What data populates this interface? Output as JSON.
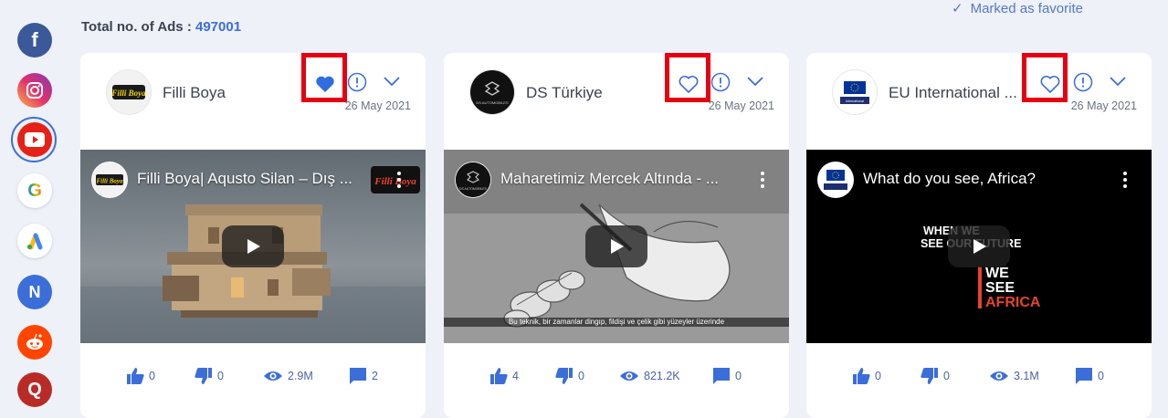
{
  "header": {
    "total_label": "Total no. of Ads :",
    "total_value": "497001",
    "favorite_label": "Marked as favorite"
  },
  "sidebar": {
    "networks": [
      {
        "name": "facebook-icon",
        "glyph": "f",
        "color": "#3b5998"
      },
      {
        "name": "instagram-icon",
        "glyph": "",
        "color": "#d6249f"
      },
      {
        "name": "youtube-icon",
        "glyph": "",
        "color": "#e62117"
      },
      {
        "name": "google-icon",
        "glyph": "G",
        "color": "#ffffff"
      },
      {
        "name": "google-ads-icon",
        "glyph": "",
        "color": "#ffffff"
      },
      {
        "name": "native-icon",
        "glyph": "N",
        "color": "#3b6ed8"
      },
      {
        "name": "reddit-icon",
        "glyph": "",
        "color": "#ff4500"
      },
      {
        "name": "quora-icon",
        "glyph": "Q",
        "color": "#b92b27"
      }
    ],
    "active": "youtube"
  },
  "cards": [
    {
      "advertiser": "Filli Boya",
      "date": "26 May 2021",
      "favorited": true,
      "video_title": "Filli Boya| Aqusto Silan – Dış ...",
      "subtitle": "",
      "stats": {
        "likes": "0",
        "dislikes": "0",
        "views": "2.9M",
        "comments": "2"
      }
    },
    {
      "advertiser": "DS Türkiye",
      "date": "26 May 2021",
      "favorited": false,
      "video_title": "Maharetimiz Mercek Altında - ...",
      "subtitle": "Bu teknik, bir zamanlar dingıp, fildişi ve çelik gibi yüzeyler üzerinde",
      "stats": {
        "likes": "4",
        "dislikes": "0",
        "views": "821.2K",
        "comments": "0"
      }
    },
    {
      "advertiser": "EU International ...",
      "date": "26 May 2021",
      "favorited": false,
      "video_title": "What do you see, Africa?",
      "subtitle": "",
      "overlay_text": {
        "line1": "WHEN WE",
        "line2": "SEE OUR FUTURE",
        "line3": "WE",
        "line4": "SEE",
        "line5": "AFRICA"
      },
      "stats": {
        "likes": "0",
        "dislikes": "0",
        "views": "3.1M",
        "comments": "0"
      }
    }
  ],
  "colors": {
    "accent": "#3b6ed8",
    "highlight": "#e60012",
    "stat": "#4a64a8"
  }
}
